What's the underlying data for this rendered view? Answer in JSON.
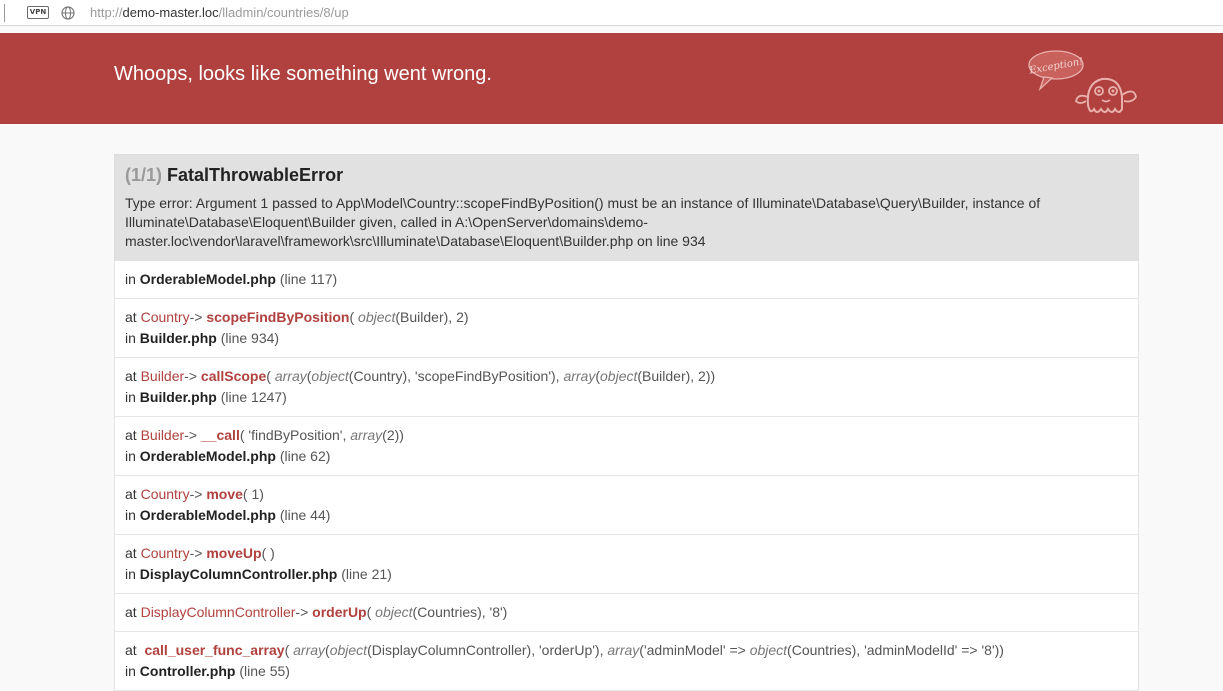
{
  "browser": {
    "vpn_label": "VPN",
    "url_scheme": "http://",
    "url_host": "demo-master.loc",
    "url_path": "/lladmin/countries/8/up"
  },
  "header": {
    "title": "Whoops, looks like something went wrong.",
    "mascot_bubble": "Exception!"
  },
  "error": {
    "count": "(1/1)",
    "type": "FatalThrowableError",
    "message": "Type error: Argument 1 passed to App\\Model\\Country::scopeFindByPosition() must be an instance of Illuminate\\Database\\Query\\Builder, instance of Illuminate\\Database\\Eloquent\\Builder given, called in A:\\OpenServer\\domains\\demo-master.loc\\vendor\\laravel\\framework\\src\\Illuminate\\Database\\Eloquent\\Builder.php on line 934"
  },
  "trace": [
    {
      "file": "OrderableModel.php",
      "line": "(line 117)"
    },
    {
      "class": "Country",
      "function": "scopeFindByPosition",
      "file": "Builder.php",
      "line": "(line 934)"
    },
    {
      "class": "Builder",
      "function": "callScope",
      "file": "Builder.php",
      "line": "(line 1247)"
    },
    {
      "class": "Builder",
      "function": "__call",
      "file": "OrderableModel.php",
      "line": "(line 62)"
    },
    {
      "class": "Country",
      "function": "move",
      "file": "OrderableModel.php",
      "line": "(line 44)"
    },
    {
      "class": "Country",
      "function": "moveUp",
      "file": "DisplayColumnController.php",
      "line": "(line 21)"
    },
    {
      "class": "DisplayColumnController",
      "function": "orderUp"
    },
    {
      "function": "call_user_func_array",
      "file": "Controller.php",
      "line": "(line 55)"
    }
  ],
  "theme": {
    "header_color": "#b0413e",
    "accent": "#b0413e"
  }
}
